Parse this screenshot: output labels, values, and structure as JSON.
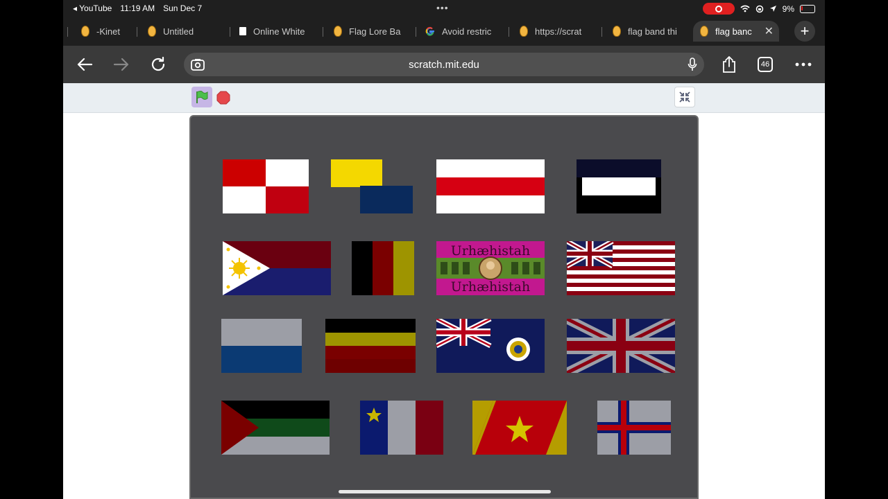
{
  "status_bar": {
    "back_app": "◂ YouTube",
    "time": "11:19 AM",
    "date": "Sun Dec 7",
    "battery": "9%"
  },
  "tabs": [
    {
      "title": "-Kinet"
    },
    {
      "title": "Untitled"
    },
    {
      "title": "Online White"
    },
    {
      "title": "Flag Lore Ba"
    },
    {
      "title": "Avoid restric"
    },
    {
      "title": "https://scrat"
    },
    {
      "title": "flag band thi"
    },
    {
      "title": "flag banc",
      "active": true
    }
  ],
  "tab_count": "46",
  "address_bar": {
    "url": "scratch.mit.edu"
  },
  "stage": {
    "flag_text_top": "Urhæhistah",
    "flag_text_bottom": "Urhæhistah"
  }
}
